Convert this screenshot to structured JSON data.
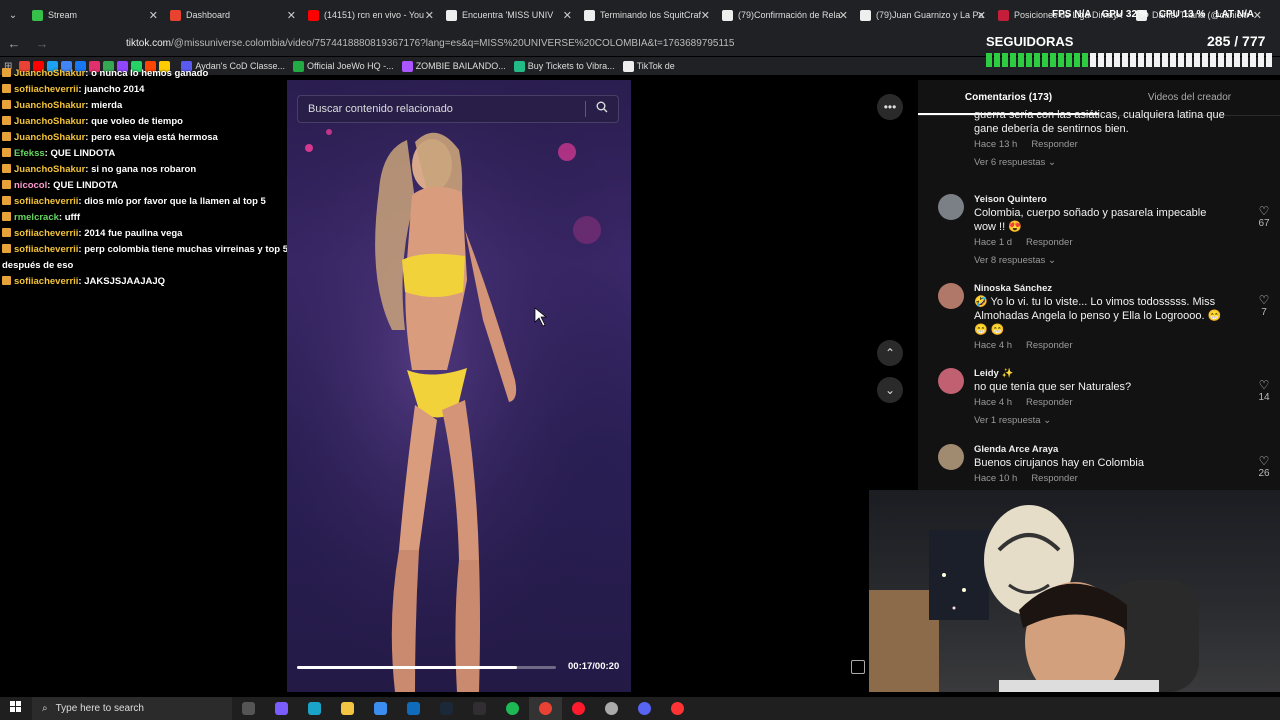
{
  "browser": {
    "tabs": [
      {
        "title": "Stream",
        "color": "#36c24a"
      },
      {
        "title": "Dashboard",
        "color": "#e8432f"
      },
      {
        "title": "(14151) rcn en vivo - You",
        "color": "#ff0000"
      },
      {
        "title": "Encuentra 'MISS UNIV",
        "color": "#eeeeee"
      },
      {
        "title": "Terminando los SquitCraf",
        "color": "#eeeeee"
      },
      {
        "title": "(79)Confirmación de Rela",
        "color": "#eeeeee"
      },
      {
        "title": "(79)Juan Guarnizo y La Pa",
        "color": "#eeeeee"
      },
      {
        "title": "Posiciones de Liga Dimay",
        "color": "#c41e3a"
      },
      {
        "title": "Daniel Triana (@danieltr",
        "color": "#eeeeee"
      }
    ],
    "url_host": "tiktok.com",
    "url_path": "/@missuniverse.colombia/video/7574418880819367176?lang=es&q=MISS%20UNIVERSE%20COLOMBIA&t=1763689795115",
    "bookmarks": [
      {
        "label": "Aydan's CoD Classe...",
        "color": "#5a5af0"
      },
      {
        "label": "Official JoeWo HQ -...",
        "color": "#22aa44"
      },
      {
        "label": "ZOMBIE BAILANDO...",
        "color": "#aa55ff"
      },
      {
        "label": "Buy Tickets to Vibra...",
        "color": "#22bb88"
      },
      {
        "label": "TikTok de",
        "color": "#eeeeee"
      }
    ]
  },
  "chat": [
    {
      "user": "JuanchoShakur",
      "text": "o nunca lo hemos ganado",
      "color": "yellow"
    },
    {
      "user": "sofiiacheverrii",
      "text": "juancho 2014",
      "color": "yellow"
    },
    {
      "user": "JuanchoShakur",
      "text": "mierda",
      "color": "yellow"
    },
    {
      "user": "JuanchoShakur",
      "text": "que voleo de tiempo",
      "color": "yellow"
    },
    {
      "user": "JuanchoShakur",
      "text": "pero esa vieja está hermosa",
      "color": "yellow"
    },
    {
      "user": "Efekss",
      "text": "QUE LINDOTA",
      "color": "green"
    },
    {
      "user": "JuanchoShakur",
      "text": "si no gana nos robaron",
      "color": "yellow"
    },
    {
      "user": "nicocol",
      "text": "QUE LINDOTA",
      "color": "pink"
    },
    {
      "user": "sofiiacheverrii",
      "text": "dios mío por favor que la llamen al top 5",
      "color": "yellow"
    },
    {
      "user": "rmelcrack",
      "text": "ufff",
      "color": "green"
    },
    {
      "user": "sofiiacheverrii",
      "text": "2014 fue paulina vega",
      "color": "yellow"
    },
    {
      "user": "sofiiacheverrii",
      "text": "perp colombia tiene muchas virreinas y top 5 después de eso",
      "color": "yellow"
    },
    {
      "user": "sofiiacheverrii",
      "text": "JAKSJSJAAJAJQ",
      "color": "yellow"
    }
  ],
  "video": {
    "search_placeholder": "Buscar contenido relacionado",
    "time": "00:17/00:20",
    "progress": 0.85
  },
  "comments": {
    "tab_comments": "Comentarios (173)",
    "tab_creator": "Videos del creador",
    "items": [
      {
        "name": "",
        "line1": "guerra sería con las asiáticas, cualquiera latina que",
        "line2": "gane debería de sentirnos bien.",
        "time": "Hace 13 h",
        "reply": "Responder",
        "replies": "Ver 6 respuestas",
        "likes": "",
        "avatar": "#444"
      },
      {
        "name": "Yeison Quintero",
        "line1": "Colombia, cuerpo soñado y pasarela impecable",
        "line2": "wow !! 😍",
        "time": "Hace 1 d",
        "reply": "Responder",
        "replies": "Ver 8 respuestas",
        "likes": "67",
        "avatar": "#7b7f86"
      },
      {
        "name": "Ninoska Sánchez",
        "line1": "🤣 Yo lo vi. tu lo viste... Lo vimos todosssss. Miss",
        "line2": "Almohadas Angela lo penso y Ella lo Logroooo. 😁",
        "line3": "😁 😁",
        "time": "Hace 4 h",
        "reply": "Responder",
        "replies": "",
        "likes": "7",
        "avatar": "#b07868"
      },
      {
        "name": "Leidy ✨",
        "line1": "no que tenía que ser Naturales?",
        "line2": "",
        "time": "Hace 4 h",
        "reply": "Responder",
        "replies": "Ver 1 respuesta",
        "likes": "14",
        "avatar": "#c06070"
      },
      {
        "name": "Glenda Arce Araya",
        "line1": "Buenos cirujanos hay en Colombia",
        "line2": "",
        "time": "Hace 10 h",
        "reply": "Responder",
        "replies": "",
        "likes": "26",
        "avatar": "#a08a70"
      }
    ]
  },
  "overlay": {
    "fps": "FPS N/A",
    "gpu": "GPU 32 %",
    "cpu": "CPU 13 %",
    "lat": "LAT N/A",
    "seguidoras": "SEGUIDORAS",
    "counter": "285 / 777",
    "meter_filled_fraction": 0.37
  },
  "taskbar": {
    "search_placeholder": "Type here to search"
  }
}
